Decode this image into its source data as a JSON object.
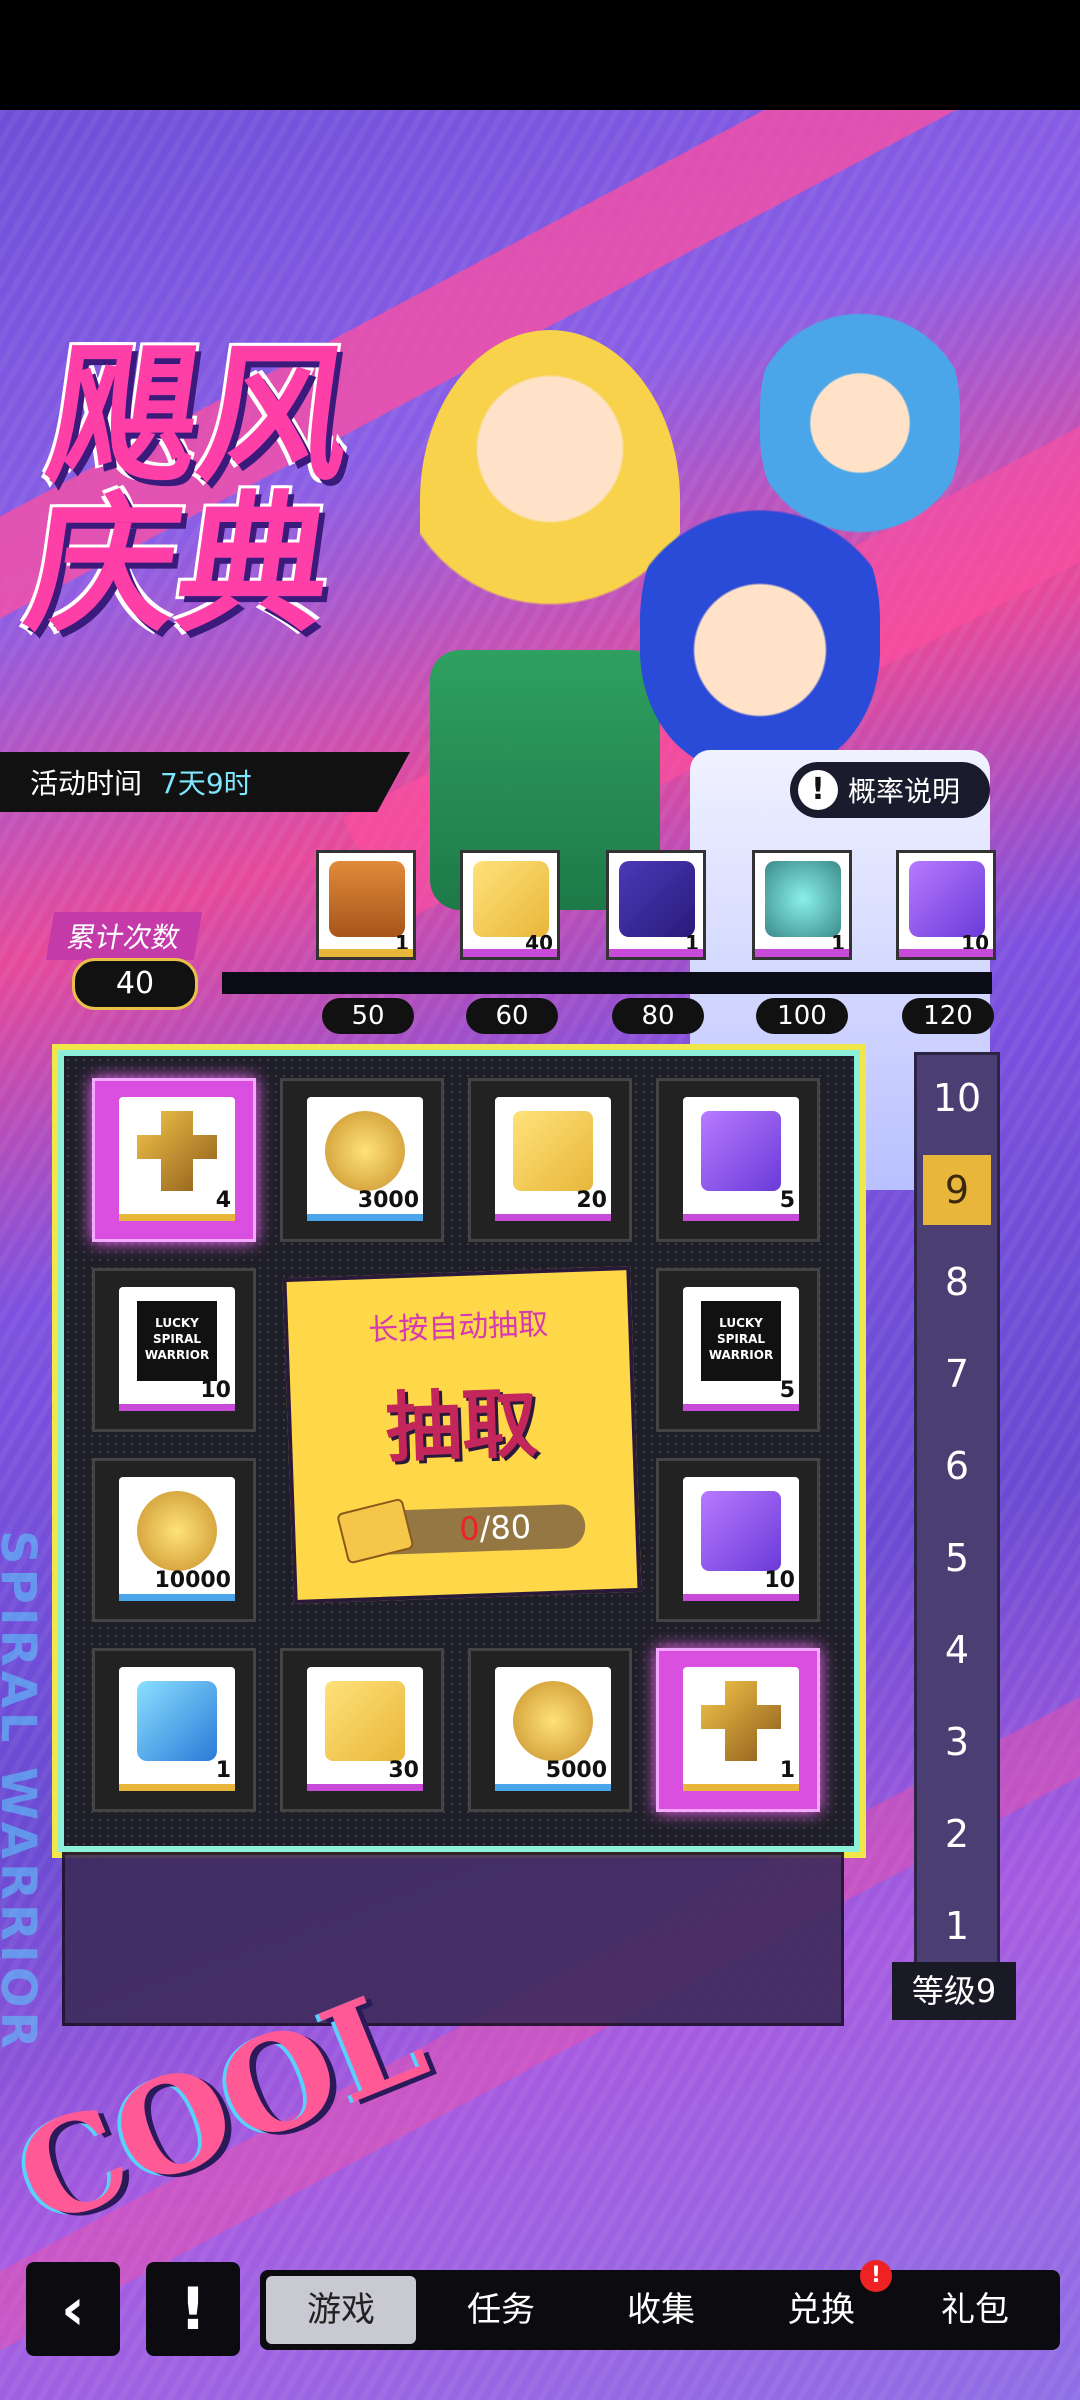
{
  "event": {
    "title_line1": "飓风",
    "title_line2": "庆典",
    "activity_time_label": "活动时间",
    "activity_time_value": "7天9时",
    "probability_label": "概率说明"
  },
  "progress": {
    "cumulative_label": "累计次数",
    "cumulative_value": "40",
    "milestones": [
      {
        "threshold": "50",
        "quantity": "1",
        "icon": "treasure-chest-icon"
      },
      {
        "threshold": "60",
        "quantity": "40",
        "icon": "gold-ticket-icon"
      },
      {
        "threshold": "80",
        "quantity": "1",
        "icon": "gift-box-icon"
      },
      {
        "threshold": "100",
        "quantity": "1",
        "icon": "crystal-device-icon"
      },
      {
        "threshold": "120",
        "quantity": "10",
        "icon": "purple-ticket-icon"
      }
    ]
  },
  "board": {
    "cells": [
      {
        "quantity": "4",
        "icon": "gold-emblem-icon"
      },
      {
        "quantity": "3000",
        "icon": "gold-coin-icon"
      },
      {
        "quantity": "20",
        "icon": "gold-ticket-icon"
      },
      {
        "quantity": "5",
        "icon": "purple-ticket-icon"
      },
      {
        "quantity": "10",
        "icon": "lucky-spiral-warrior-ticket-icon"
      },
      {
        "quantity": "5",
        "icon": "lucky-spiral-warrior-ticket-icon"
      },
      {
        "quantity": "10000",
        "icon": "gold-coin-icon"
      },
      {
        "quantity": "10",
        "icon": "purple-ticket-icon"
      },
      {
        "quantity": "1",
        "icon": "blue-chest-icon"
      },
      {
        "quantity": "30",
        "icon": "gold-ticket-icon"
      },
      {
        "quantity": "5000",
        "icon": "gold-coin-icon"
      },
      {
        "quantity": "1",
        "icon": "gold-emblem-icon"
      }
    ],
    "lucky_text": [
      "LUCKY",
      "SPIRAL",
      "WARRIOR"
    ],
    "auto_draw_label": "长按自动抽取",
    "draw_label": "抽取",
    "cost_current": "0",
    "cost_total": "/80"
  },
  "levels": {
    "items": [
      "10",
      "9",
      "8",
      "7",
      "6",
      "5",
      "4",
      "3",
      "2",
      "1"
    ],
    "selected": "9",
    "current_label": "等级9"
  },
  "decor": {
    "cool_text": "COOL",
    "spiral_text": "SPIRAL WARRIOR"
  },
  "nav": {
    "back_icon": "‹",
    "info_icon": "!",
    "tabs": [
      "游戏",
      "任务",
      "收集",
      "兑换",
      "礼包"
    ],
    "active_tab": "游戏",
    "badge": "!"
  },
  "colors": {
    "highlight_cell": "#d94fe0",
    "board_border": "#8df0d8",
    "level_selected": "#e8b63a",
    "draw_panel": "#ffd84a"
  }
}
